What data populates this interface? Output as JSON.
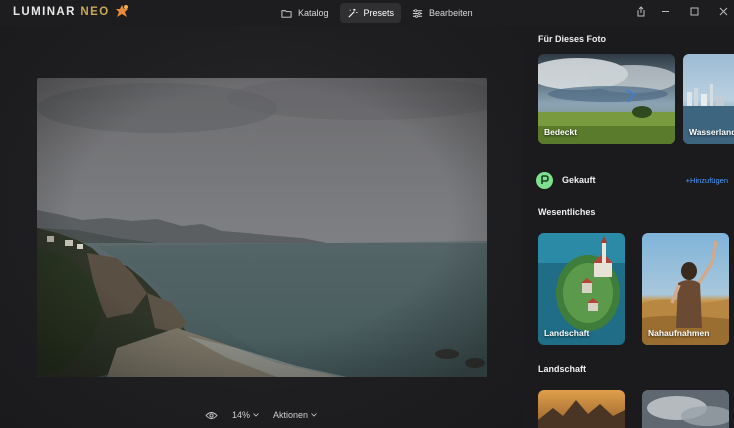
{
  "app": {
    "logo_main": "LUMINAR ",
    "logo_accent": "NEO"
  },
  "topnav": {
    "items": [
      {
        "label": "Katalog",
        "icon": "folder-icon"
      },
      {
        "label": "Presets",
        "icon": "magic-wand-icon",
        "active": true
      },
      {
        "label": "Bearbeiten",
        "icon": "sliders-icon"
      }
    ]
  },
  "window_controls": [
    "share-icon",
    "minimize-icon",
    "maximize-icon",
    "close-icon"
  ],
  "bottombar": {
    "zoom": "14%",
    "actions": "Aktionen"
  },
  "panel": {
    "for_photo_title": "Für Dieses Foto",
    "for_photo_cards": [
      "Bedeckt",
      "Wasserland"
    ],
    "purchased_label": "Gekauft",
    "add_label": "+Hinzufügen",
    "essentials_title": "Wesentliches",
    "essentials_cards": [
      "Landschaft",
      "Nahaufnahmen"
    ],
    "landscape_title": "Landschaft"
  },
  "colors": {
    "accent_blue": "#4b9bff",
    "active_nav": "#303033",
    "gekauft_green": "#7ee08f"
  }
}
